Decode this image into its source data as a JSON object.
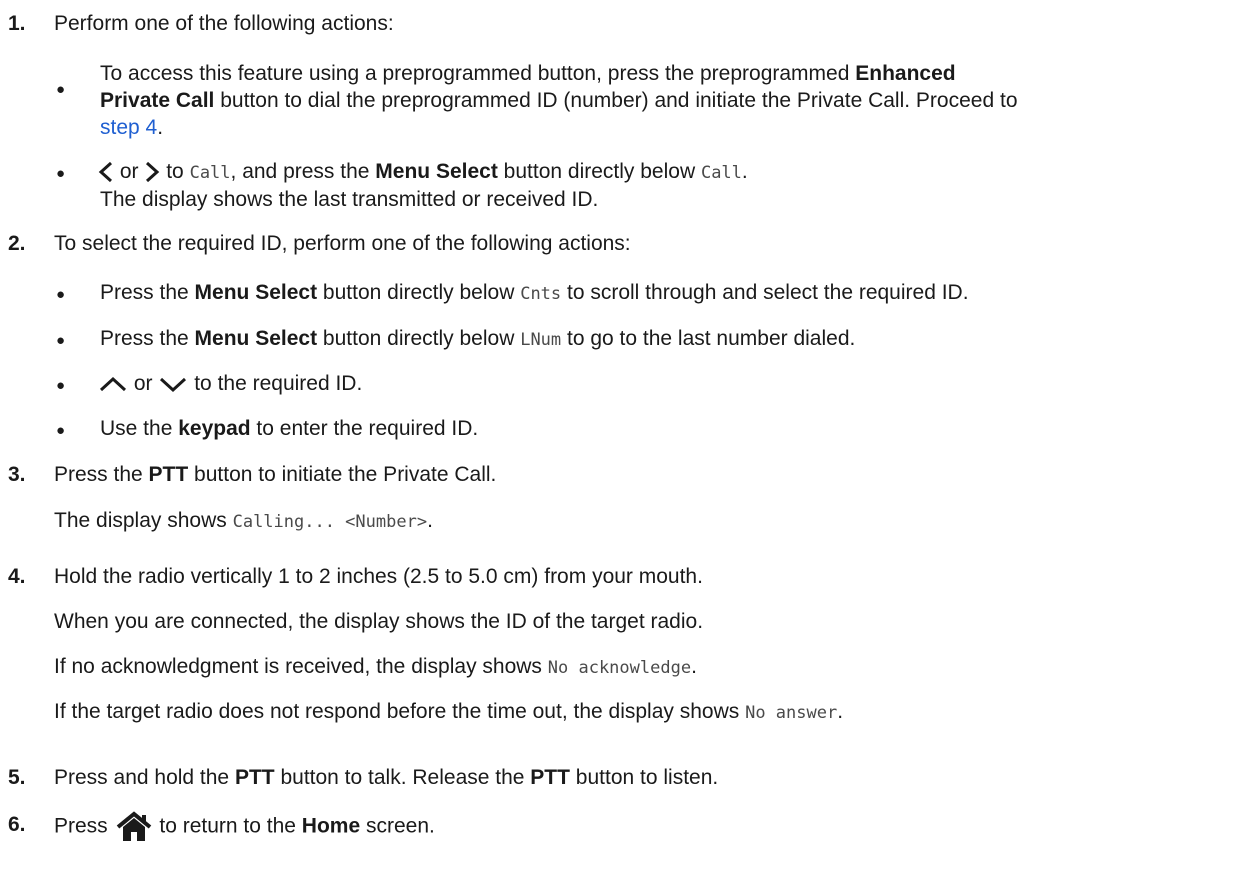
{
  "steps": {
    "s1": {
      "num": "1.",
      "intro": "Perform one of the following actions:",
      "b1": {
        "pre": "To access this feature using a preprogrammed button, press the preprogrammed ",
        "bold1": "Enhanced",
        "bold2": "Private Call",
        "rest": " button to dial the preprogrammed ID (number) and initiate the Private Call. Proceed to",
        "link": "step 4",
        "end": "."
      },
      "b2": {
        "or": "or",
        "to": "to",
        "call1": "Call",
        "mid": ", and press the ",
        "bold": "Menu Select",
        "after": " button directly below ",
        "call2": "Call",
        "end": ".",
        "result": "The display shows the last transmitted or received ID."
      }
    },
    "s2": {
      "num": "2.",
      "intro": "To select the required ID, perform one of the following actions:",
      "b1": {
        "pre": "Press the ",
        "bold": "Menu Select",
        "mid": " button directly below ",
        "code": "Cnts",
        "post": " to scroll through and select the required ID."
      },
      "b2": {
        "pre": "Press the ",
        "bold": "Menu Select",
        "mid": " button directly below ",
        "code": "LNum",
        "post": " to go to the last number dialed."
      },
      "b3": {
        "or": "or",
        "post": "to the required ID."
      },
      "b4": {
        "pre": "Use the ",
        "bold": "keypad",
        "post": " to enter the required ID."
      }
    },
    "s3": {
      "num": "3.",
      "pre": "Press the ",
      "bold": "PTT",
      "post": " button to initiate the Private Call.",
      "result_pre": "The display shows ",
      "result_code": "Calling... <Number>",
      "result_end": "."
    },
    "s4": {
      "num": "4.",
      "text": "Hold the radio vertically 1 to 2 inches (2.5 to 5.0 cm) from your mouth.",
      "r1": "When you are connected, the display shows the ID of the target radio.",
      "r2_pre": "If no acknowledgment is received, the display shows ",
      "r2_code": "No acknowledge",
      "r2_end": ".",
      "r3_pre": "If the target radio does not respond before the time out, the display shows ",
      "r3_code": "No answer",
      "r3_end": "."
    },
    "s5": {
      "num": "5.",
      "pre": "Press and hold the ",
      "bold1": "PTT",
      "mid": " button to talk. Release the ",
      "bold2": "PTT",
      "post": " button to listen."
    },
    "s6": {
      "num": "6.",
      "pre": "Press",
      "mid": "to return to the ",
      "bold": "Home",
      "post": " screen."
    }
  },
  "icons": [
    "left-arrow-icon",
    "right-arrow-icon",
    "up-arrow-icon",
    "down-arrow-icon",
    "home-icon"
  ],
  "colors": {
    "link": "#1f5fd1",
    "text": "#1a1a1a",
    "code": "#4a4a4a"
  }
}
